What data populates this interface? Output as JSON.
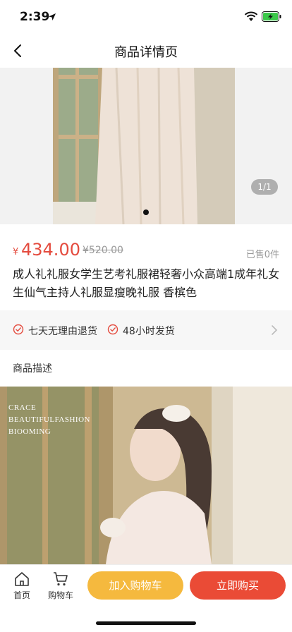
{
  "status_bar": {
    "time": "2:39"
  },
  "nav": {
    "title": "商品详情页"
  },
  "gallery": {
    "indicator": "1/1"
  },
  "product": {
    "currency": "¥",
    "price": "434.00",
    "original_price": "¥520.00",
    "sold": "已售0件",
    "title": "成人礼礼服女学生艺考礼服裙轻奢小众高端1成年礼女生仙气主持人礼服显瘦晚礼服 香槟色"
  },
  "service": {
    "items": [
      {
        "label": "七天无理由退货"
      },
      {
        "label": "48小时发货"
      }
    ]
  },
  "description": {
    "title": "商品描述",
    "image_text": [
      "CRACE",
      "BEAUTIFULFASHION",
      "BIOOMING"
    ]
  },
  "bottom_bar": {
    "home_label": "首页",
    "cart_label": "购物车",
    "add_to_cart": "加入购物车",
    "buy_now": "立即购买"
  },
  "colors": {
    "price": "#e44b3e",
    "add_to_cart": "#f5b93e",
    "buy_now": "#ea4b36"
  }
}
